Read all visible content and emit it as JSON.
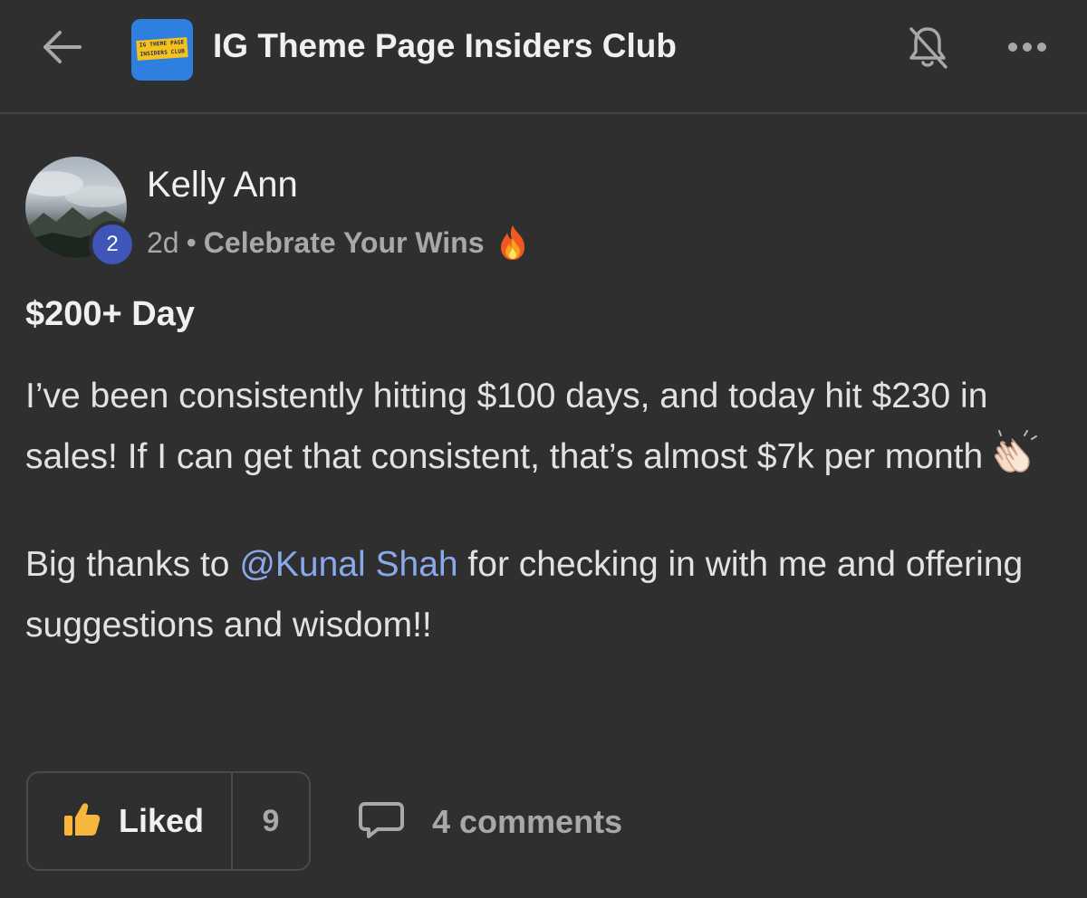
{
  "header": {
    "group_title": "IG Theme Page Insiders Club",
    "logo_text_line1": "IG THEME PAGE",
    "logo_text_line2": "INSIDERS CLUB",
    "icons": [
      "back-arrow-icon",
      "bell-off-icon",
      "more-horizontal-icon"
    ]
  },
  "post": {
    "author_name": "Kelly Ann",
    "level": "2",
    "age": "2d",
    "separator": "•",
    "category": "Celebrate Your Wins",
    "category_emoji": "fire",
    "title": "$200+ Day",
    "paragraph1": "I’ve been consistently hitting $100 days, and today hit $230 in sales! If I can get that consistent, that’s almost $7k per month",
    "paragraph1_emoji": "clapping-hands",
    "paragraph2_before": "Big thanks to ",
    "mention": "@Kunal Shah",
    "paragraph2_after": " for checking in with me and offering suggestions and wisdom!!"
  },
  "actions": {
    "like_label": "Liked",
    "like_count": "9",
    "comments_label": "4 comments"
  },
  "colors": {
    "background": "#2f2f30",
    "mention": "#8aa8ec",
    "level_badge": "#3f56b8",
    "logo_blue": "#2f7fe0",
    "logo_yellow": "#f5c21b",
    "like_icon": "#f6b73c"
  }
}
